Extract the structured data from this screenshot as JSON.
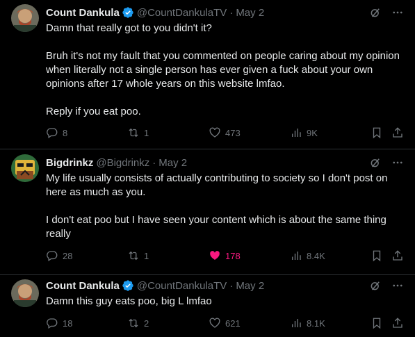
{
  "colors": {
    "background": "#000000",
    "text": "#e7e9ea",
    "muted": "#71767b",
    "verified": "#1d9bf0",
    "like": "#f91880",
    "divider": "#2f3336"
  },
  "tweets": [
    {
      "display_name": "Count Dankula",
      "verified": true,
      "handle": "@CountDankulaTV",
      "separator": "·",
      "date": "May 2",
      "paragraphs": [
        "Damn that really got to you didn't it?",
        "Bruh it's not my fault that you commented on people caring about my opinion when literally not a single person has ever given a fuck about your own opinions after 17 whole years on this website lmfao.",
        "Reply if you eat poo."
      ],
      "replies": "8",
      "reposts": "1",
      "likes": "473",
      "views": "9K",
      "liked": false
    },
    {
      "display_name": "Bigdrinkz",
      "verified": false,
      "handle": "@Bigdrinkz",
      "separator": "·",
      "date": "May 2",
      "paragraphs": [
        "My life usually consists of actually contributing to society so I don't post on here as much as you.",
        "I don't eat poo but I have seen your content which is about the same thing really"
      ],
      "replies": "28",
      "reposts": "1",
      "likes": "178",
      "views": "8.4K",
      "liked": true
    },
    {
      "display_name": "Count Dankula",
      "verified": true,
      "handle": "@CountDankulaTV",
      "separator": "·",
      "date": "May 2",
      "paragraphs": [
        "Damn this guy eats poo, big L lmfao"
      ],
      "replies": "18",
      "reposts": "2",
      "likes": "621",
      "views": "8.1K",
      "liked": false
    }
  ]
}
